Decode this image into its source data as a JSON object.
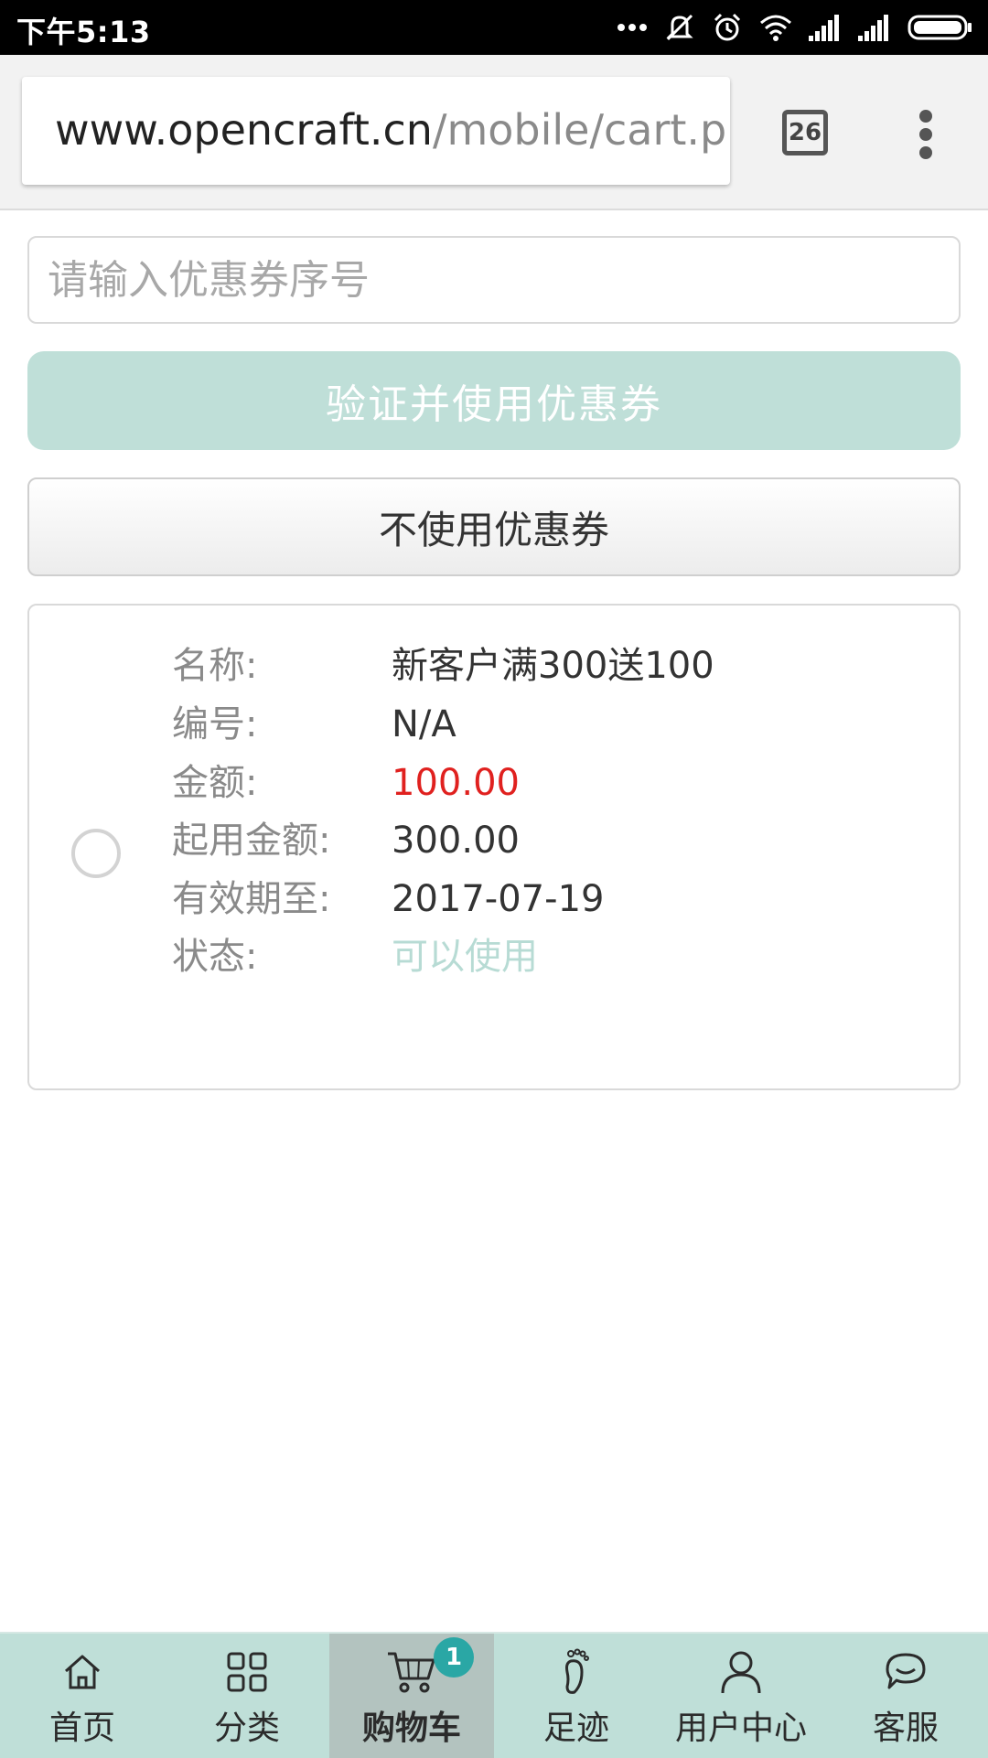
{
  "status_bar": {
    "time": "下午5:13",
    "icons": [
      "more-dots-icon",
      "mute-icon",
      "alarm-icon",
      "wifi-icon",
      "signal-icon",
      "signal-icon",
      "battery-icon"
    ]
  },
  "browser": {
    "url_host": "www.opencraft.cn",
    "url_path": "/mobile/cart.ph",
    "tab_count": "26"
  },
  "coupon_form": {
    "input_placeholder": "请输入优惠券序号",
    "input_value": "",
    "verify_button": "验证并使用优惠券",
    "no_coupon_button": "不使用优惠券"
  },
  "coupon": {
    "selected": false,
    "rows": [
      {
        "label": "名称:",
        "value": "新客户满300送100"
      },
      {
        "label": "编号:",
        "value": "N/A"
      },
      {
        "label": "金额:",
        "value": "100.00"
      },
      {
        "label": "起用金额:",
        "value": "300.00"
      },
      {
        "label": "有效期至:",
        "value": "2017-07-19"
      },
      {
        "label": "状态:",
        "value": "可以使用"
      }
    ]
  },
  "bottom_nav": {
    "items": [
      {
        "label": "首页",
        "icon": "home-icon"
      },
      {
        "label": "分类",
        "icon": "grid-icon"
      },
      {
        "label": "购物车",
        "icon": "cart-icon",
        "badge": "1",
        "active": true
      },
      {
        "label": "足迹",
        "icon": "footprint-icon"
      },
      {
        "label": "用户中心",
        "icon": "user-icon"
      },
      {
        "label": "客服",
        "icon": "chat-icon"
      }
    ]
  },
  "colors": {
    "accent": "#bfdfd8",
    "amount_red": "#e0211f",
    "status_green": "#b7dbd4",
    "badge": "#2aa7a5"
  }
}
